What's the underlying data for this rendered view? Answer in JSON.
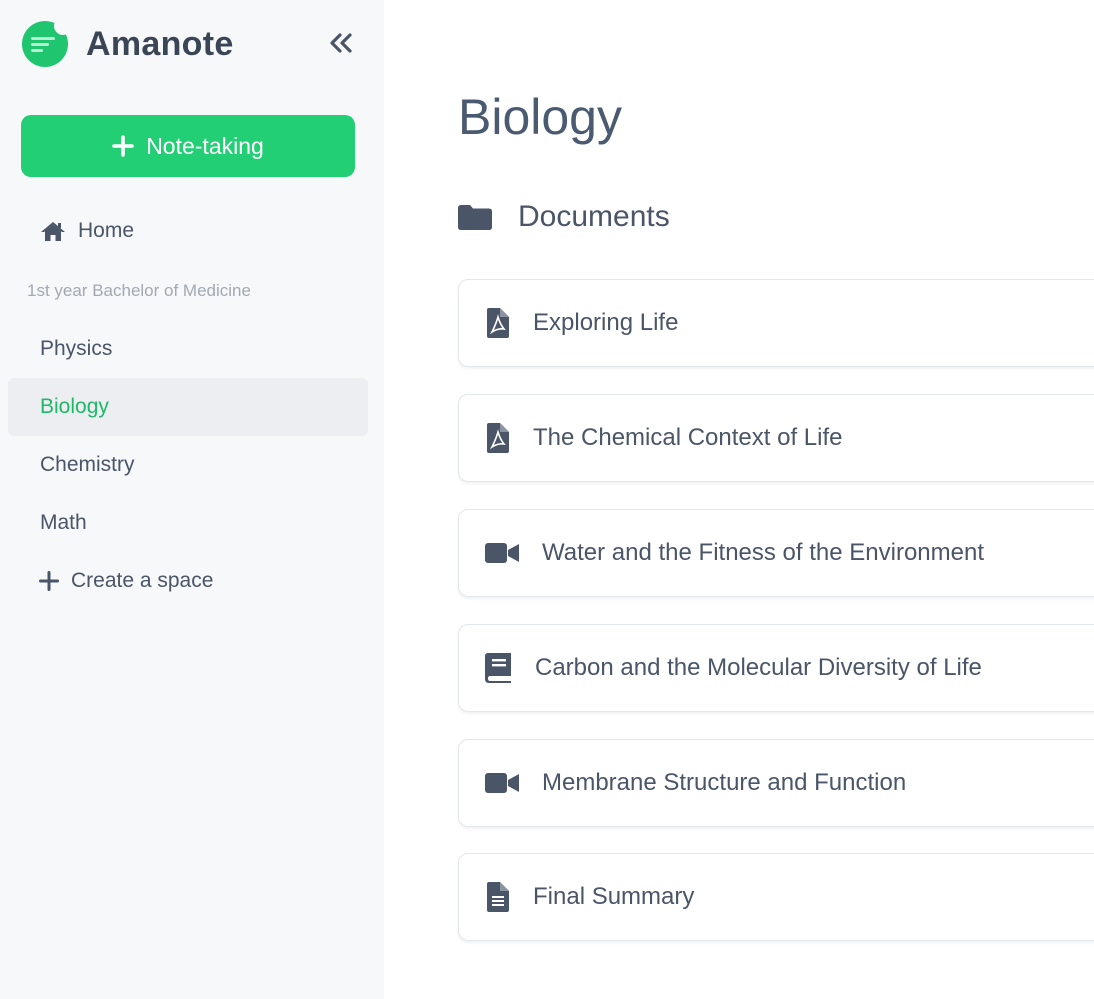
{
  "app": {
    "name": "Amanote",
    "brand_color": "#22cf74",
    "accent_text_color": "#1fb86a"
  },
  "sidebar": {
    "new_note_label": "Note-taking",
    "home_label": "Home",
    "section_label": "1st year Bachelor of Medicine",
    "items": [
      {
        "label": "Physics",
        "active": false
      },
      {
        "label": "Biology",
        "active": true
      },
      {
        "label": "Chemistry",
        "active": false
      },
      {
        "label": "Math",
        "active": false
      }
    ],
    "create_label": "Create a space"
  },
  "main": {
    "title": "Biology",
    "section_title": "Documents",
    "documents": [
      {
        "title": "Exploring Life",
        "icon": "pdf-file-icon"
      },
      {
        "title": "The Chemical Context of Life",
        "icon": "pdf-file-icon"
      },
      {
        "title": "Water and the Fitness of the Environment",
        "icon": "video-camera-icon"
      },
      {
        "title": "Carbon and the Molecular Diversity of Life",
        "icon": "book-icon"
      },
      {
        "title": "Membrane Structure and Function",
        "icon": "video-camera-icon"
      },
      {
        "title": "Final Summary",
        "icon": "text-file-icon"
      }
    ]
  }
}
